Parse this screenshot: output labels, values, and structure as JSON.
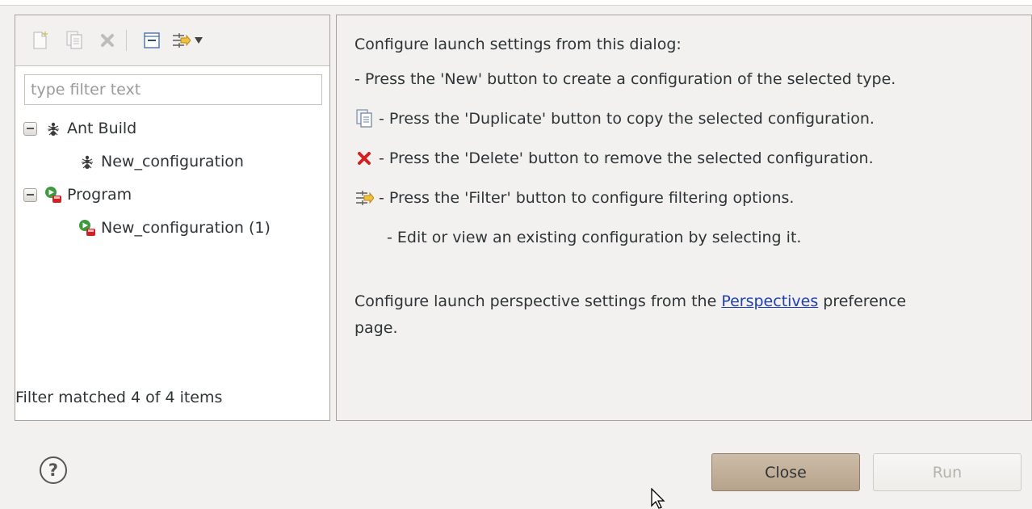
{
  "toolbar": {
    "new_icon": "new-config-icon",
    "duplicate_icon": "duplicate-icon",
    "delete_icon": "delete-icon",
    "collapse_icon": "collapse-all-icon",
    "filter_icon": "filter-icon",
    "dropdown_icon": "dropdown-arrow-icon"
  },
  "filter": {
    "placeholder": "type filter text",
    "value": ""
  },
  "tree": {
    "items": [
      {
        "label": "Ant Build",
        "icon": "ant-icon",
        "expanded": true
      },
      {
        "label": "New_configuration",
        "icon": "ant-icon"
      },
      {
        "label": "Program",
        "icon": "program-icon",
        "expanded": true
      },
      {
        "label": "New_configuration (1)",
        "icon": "program-icon"
      }
    ]
  },
  "status": "Filter matched 4 of 4 items",
  "info": {
    "intro": "Configure launch settings from this dialog:",
    "new_line": "- Press the 'New' button to create a configuration of the selected type.",
    "duplicate_line": "- Press the 'Duplicate' button to copy the selected configuration.",
    "delete_line": "- Press the 'Delete' button to remove the selected configuration.",
    "filter_line": "- Press the 'Filter' button to configure filtering options.",
    "edit_line": "- Edit or view an existing configuration by selecting it.",
    "perspective_prefix": "Configure launch perspective settings from the ",
    "perspective_link": "Perspectives",
    "perspective_suffix": " preference",
    "perspective_line2": "page."
  },
  "buttons": {
    "help": "?",
    "close": "Close",
    "run": "Run"
  },
  "colors": {
    "close_button": "#c3b19a",
    "link": "#1f3fae",
    "delete_red": "#d42020"
  }
}
